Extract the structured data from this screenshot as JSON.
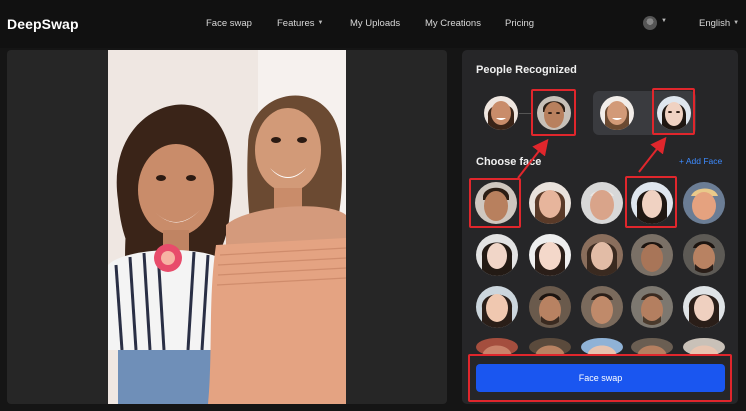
{
  "app": {
    "logo": "DeepSwap"
  },
  "nav": {
    "items": [
      {
        "label": "Face swap"
      },
      {
        "label": "Features",
        "caret": "▼"
      },
      {
        "label": "My Uploads"
      },
      {
        "label": "My Creations"
      },
      {
        "label": "Pricing"
      }
    ],
    "language": "English",
    "caret": "▼"
  },
  "panel": {
    "people_title": "People Recognized",
    "choose_title": "Choose face",
    "add_face": "+ Add Face",
    "swap_label": "Face swap"
  },
  "colors": {
    "accent": "#1a56f0",
    "link": "#3d8bff",
    "highlight": "#e0262c",
    "panel": "#262628",
    "background": "#151515"
  },
  "icons": [
    "user-avatar-icon",
    "chevron-down-icon",
    "plus-icon",
    "arrow-icon"
  ]
}
